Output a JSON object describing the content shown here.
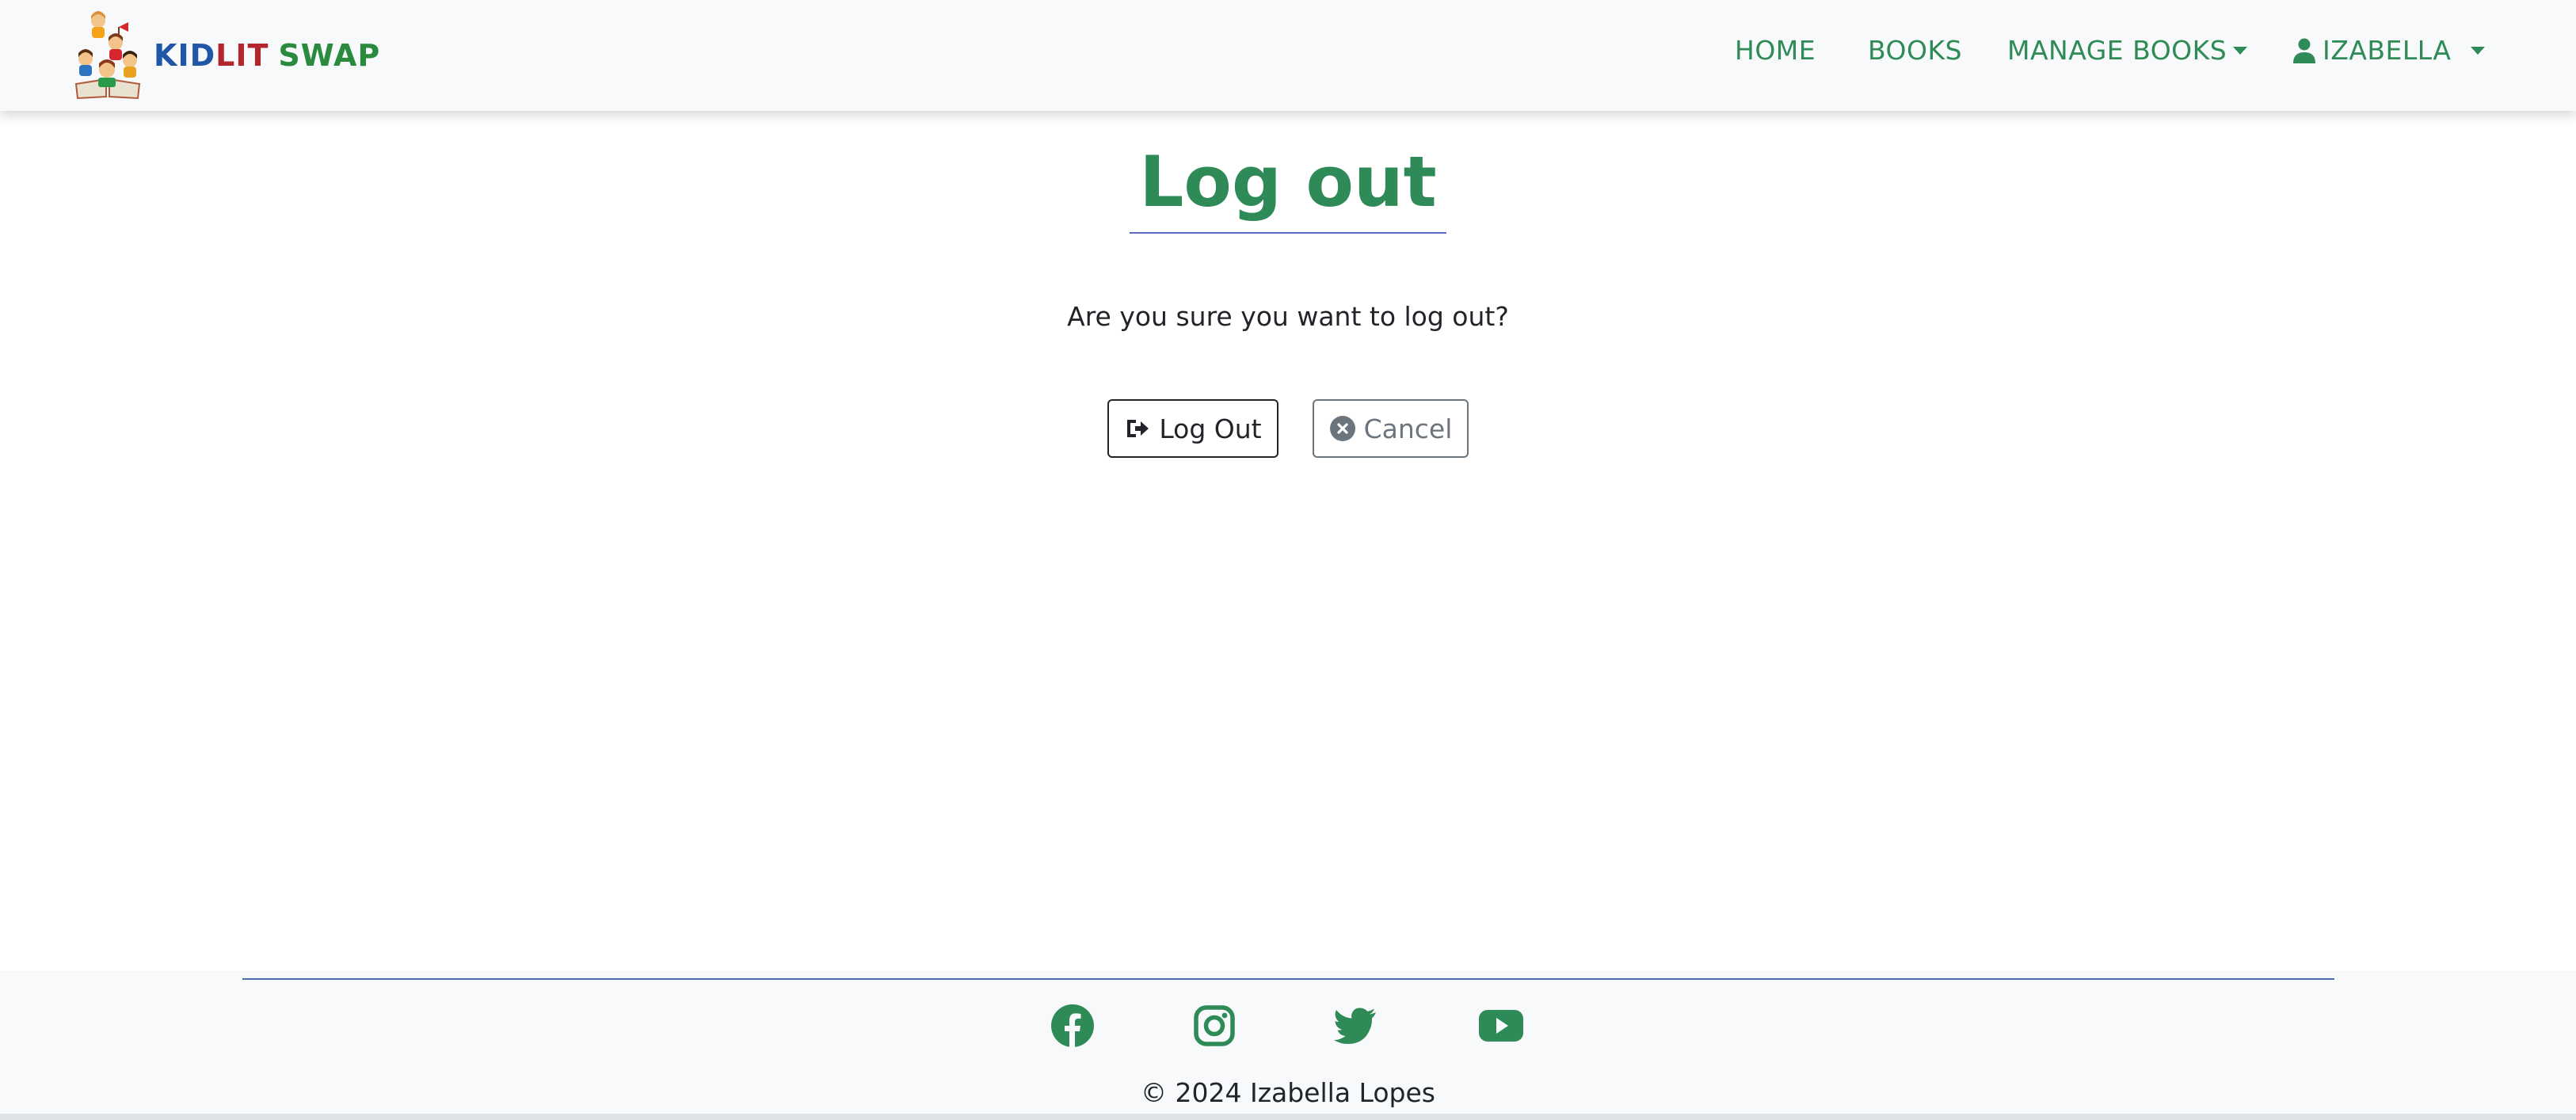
{
  "brand": {
    "word_kid": "KID",
    "word_lit": "LIT",
    "word_swap": "SWAP",
    "colors": {
      "kid": "#1f56a8",
      "lit": "#b3262e",
      "swap": "#2a8a3e"
    }
  },
  "nav": {
    "home": "HOME",
    "books": "BOOKS",
    "manage_books": "MANAGE BOOKS",
    "user": "IZABELLA",
    "accent_color": "#2e8b57"
  },
  "main": {
    "title": "Log out",
    "question": "Are you sure you want to log out?",
    "logout_button": "Log Out",
    "cancel_button": "Cancel"
  },
  "footer": {
    "social_icons": [
      "facebook-icon",
      "instagram-icon",
      "twitter-icon",
      "youtube-icon"
    ],
    "copyright": "© 2024 Izabella Lopes"
  }
}
